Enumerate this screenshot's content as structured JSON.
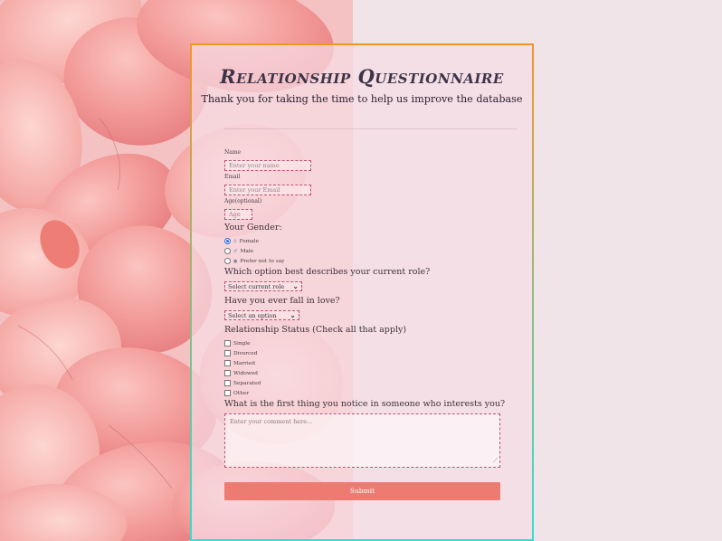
{
  "header": {
    "title": "Relationship Questionnaire",
    "subtitle": "Thank you for taking the time to help us improve the database"
  },
  "form": {
    "name": {
      "label": "Name",
      "placeholder": "Enter your name"
    },
    "email": {
      "label": "Email",
      "placeholder": "Enter your Email"
    },
    "age": {
      "label": "Age(optional)",
      "placeholder": "Age"
    },
    "gender": {
      "label": "Your Gender:",
      "options": [
        "Female",
        "Male",
        "Prefer not to say"
      ],
      "selected": "Female"
    },
    "role": {
      "label": "Which option best describes your current role?",
      "value": "Select current role"
    },
    "love": {
      "label": "Have you ever fall in love?",
      "value": "Select an option"
    },
    "status": {
      "label": "Relationship Status (Check all that apply)",
      "options": [
        "Single",
        "Divorced",
        "Married",
        "Widowed",
        "Separated",
        "Other"
      ]
    },
    "notice": {
      "label": "What is the first thing you notice in someone who interests you?",
      "placeholder": "Enter your comment here..."
    },
    "submit_label": "Submit"
  },
  "colors": {
    "accent": "#ee7b72",
    "border_top": "#f5942a",
    "border_bottom": "#2ee0d0",
    "input_border": "#c0506c",
    "radio_selected": "#2d6fe0"
  }
}
